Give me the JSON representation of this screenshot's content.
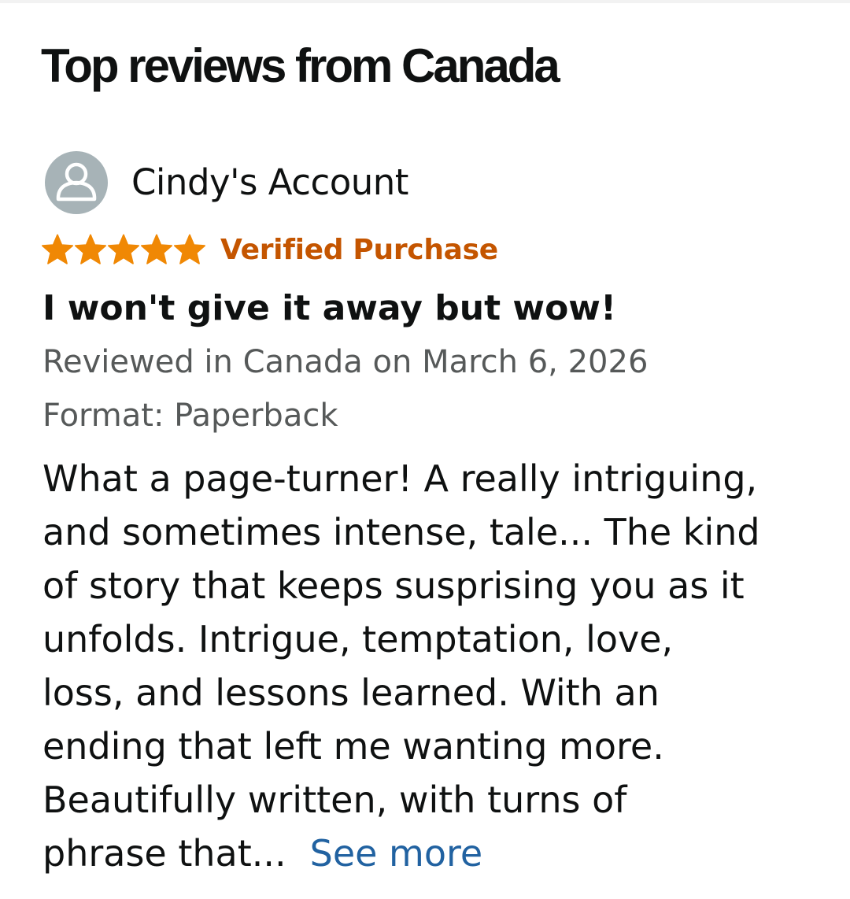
{
  "section": {
    "title": "Top reviews from Canada"
  },
  "review": {
    "reviewer": {
      "name": "Cindy's Account",
      "avatar_icon": "user-silhouette-icon"
    },
    "rating": {
      "stars": 5,
      "max": 5,
      "star_color": "#f08804"
    },
    "verified_label": "Verified Purchase",
    "verified_color": "#c45500",
    "title": "I won't give it away but wow!",
    "date_text": "Reviewed in Canada on March 6, 2026",
    "format_text": "Format: Paperback",
    "body_lines": [
      "What a page-turner! A really intriguing,",
      "and sometimes intense, tale... The kind",
      "of story that keeps susprising you as it",
      "unfolds. Intrigue, temptation, love,",
      "loss, and lessons learned. With an",
      "ending that left me wanting more.",
      "Beautifully written, with turns of",
      "phrase that..."
    ],
    "see_more_label": "See more",
    "link_color": "#2162a1"
  }
}
